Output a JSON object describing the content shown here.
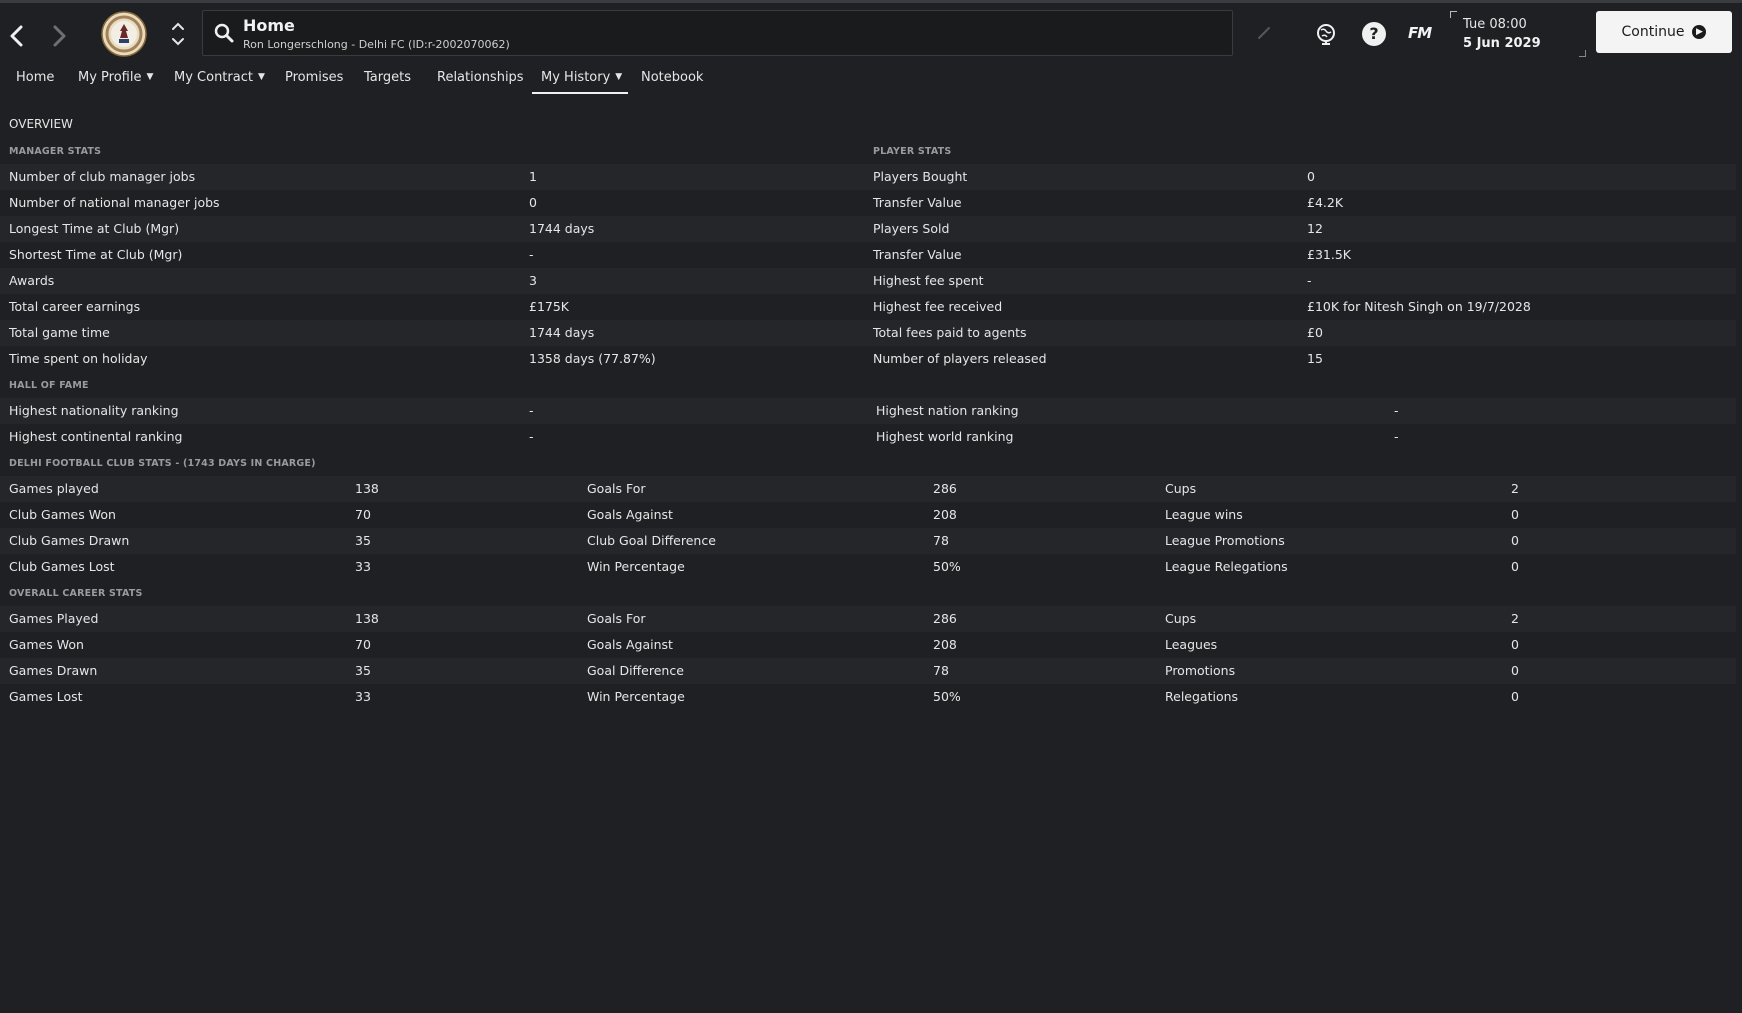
{
  "header": {
    "title": "Home",
    "subtitle": "Ron Longerschlong - Delhi FC (ID:r-2002070062)",
    "time": "Tue 08:00",
    "date": "5 Jun 2029",
    "fm_logo": "FM",
    "help_glyph": "?",
    "continue_label": "Continue"
  },
  "tabs": [
    {
      "label": "Home"
    },
    {
      "label": "My Profile"
    },
    {
      "label": "My Contract"
    },
    {
      "label": "Promises"
    },
    {
      "label": "Targets"
    },
    {
      "label": "Relationships"
    },
    {
      "label": "My History"
    },
    {
      "label": "Notebook"
    }
  ],
  "overview": {
    "title": "OVERVIEW",
    "manager_stats_title": "MANAGER STATS",
    "player_stats_title": "PLAYER STATS",
    "rows": [
      {
        "label": "Number of club manager jobs",
        "value": "1",
        "p_label": "Players Bought",
        "p_value": "0"
      },
      {
        "label": "Number of national manager jobs",
        "value": "0",
        "p_label": "Transfer Value",
        "p_value": "£4.2K"
      },
      {
        "label": "Longest Time at Club (Mgr)",
        "value": "1744 days",
        "p_label": "Players Sold",
        "p_value": "12"
      },
      {
        "label": "Shortest Time at Club (Mgr)",
        "value": "-",
        "p_label": "Transfer Value",
        "p_value": "£31.5K"
      },
      {
        "label": "Awards",
        "value": "3",
        "p_label": "Highest fee spent",
        "p_value": "-"
      },
      {
        "label": "Total career earnings",
        "value": "£175K",
        "p_label": "Highest fee received",
        "p_value": "£10K for Nitesh Singh on 19/7/2028"
      },
      {
        "label": "Total game time",
        "value": "1744 days",
        "p_label": "Total fees paid to agents",
        "p_value": "£0"
      },
      {
        "label": "Time spent on holiday",
        "value": "1358 days (77.87%)",
        "p_label": "Number of players released",
        "p_value": "15"
      }
    ]
  },
  "hall_of_fame": {
    "title": "HALL OF FAME",
    "rows": [
      {
        "label": "Highest nationality ranking",
        "value": "-",
        "r_label": "Highest nation ranking",
        "r_value": "-"
      },
      {
        "label": "Highest continental ranking",
        "value": "-",
        "r_label": "Highest world ranking",
        "r_value": "-"
      }
    ]
  },
  "club_stats": {
    "title": "DELHI FOOTBALL CLUB STATS - (1743 DAYS IN CHARGE)",
    "rows": [
      {
        "a": "Games played",
        "av": "138",
        "b": "Goals For",
        "bv": "286",
        "c": "Cups",
        "cv": "2"
      },
      {
        "a": "Club Games Won",
        "av": "70",
        "b": "Goals Against",
        "bv": "208",
        "c": "League wins",
        "cv": "0"
      },
      {
        "a": "Club Games Drawn",
        "av": "35",
        "b": "Club Goal Difference",
        "bv": "78",
        "c": "League Promotions",
        "cv": "0"
      },
      {
        "a": "Club Games Lost",
        "av": "33",
        "b": "Win Percentage",
        "bv": "50%",
        "c": "League Relegations",
        "cv": "0"
      }
    ]
  },
  "career_stats": {
    "title": "OVERALL CAREER STATS",
    "rows": [
      {
        "a": "Games Played",
        "av": "138",
        "b": "Goals For",
        "bv": "286",
        "c": "Cups",
        "cv": "2"
      },
      {
        "a": "Games Won",
        "av": "70",
        "b": "Goals Against",
        "bv": "208",
        "c": "Leagues",
        "cv": "0"
      },
      {
        "a": "Games Drawn",
        "av": "35",
        "b": "Goal Difference",
        "bv": "78",
        "c": "Promotions",
        "cv": "0"
      },
      {
        "a": "Games Lost",
        "av": "33",
        "b": "Win Percentage",
        "bv": "50%",
        "c": "Relegations",
        "cv": "0"
      }
    ]
  },
  "colors": {
    "background": "#1f2023",
    "row_alt": "#25262a",
    "text": "#e6e6e6",
    "subtitle": "#9a9b9f",
    "continue_bg": "#f4f4f4"
  }
}
